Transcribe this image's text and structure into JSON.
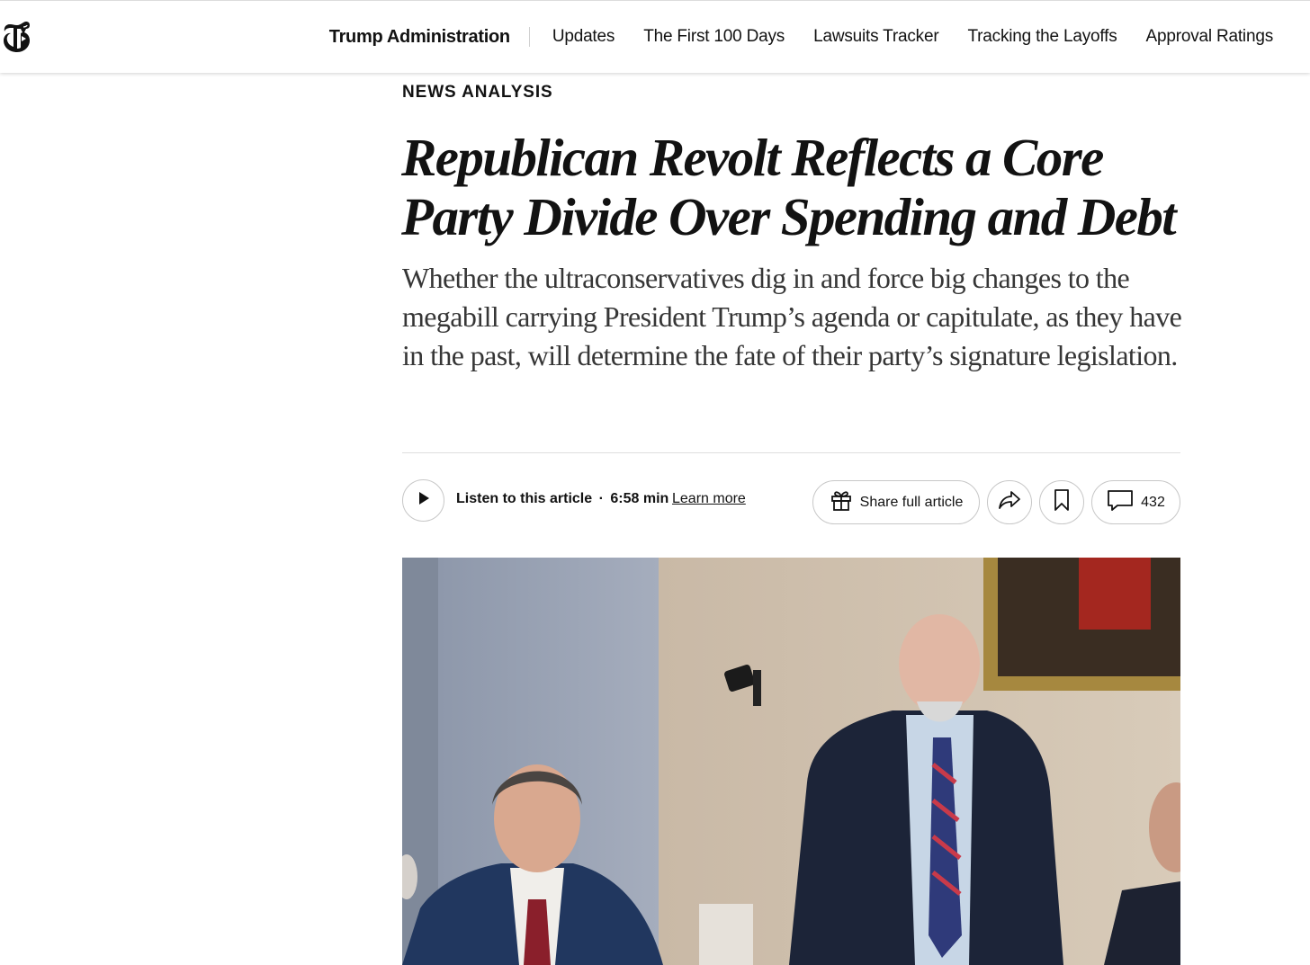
{
  "header": {
    "logo_icon": "nyt-t-logo-icon",
    "section_title": "Trump Administration",
    "nav_links": [
      "Updates",
      "The First 100 Days",
      "Lawsuits Tracker",
      "Tracking the Layoffs",
      "Approval Ratings"
    ]
  },
  "article": {
    "kicker": "NEWS ANALYSIS",
    "headline": "Republican Revolt Reflects a Core Party Divide Over Spending and Debt",
    "summary": "Whether the ultraconservatives dig in and force big changes to the megabill carrying President Trump’s agenda or capitulate, as they have in the past, will determine the fate of their party’s signature legislation."
  },
  "toolbar": {
    "listen_label": "Listen to this article",
    "separator": "·",
    "duration": "6:58 min",
    "learn_more": "Learn more",
    "share_full_label": "Share full article",
    "comment_count": "432",
    "icons": [
      "play-icon",
      "gift-icon",
      "share-arrow-icon",
      "bookmark-icon",
      "comment-bubble-icon"
    ]
  },
  "photo": {
    "icon": "hero-photo"
  },
  "colors": {
    "text": "#121212",
    "summary_text": "#363636",
    "border": "#c7c7c7",
    "divider": "#dfdfdf"
  }
}
